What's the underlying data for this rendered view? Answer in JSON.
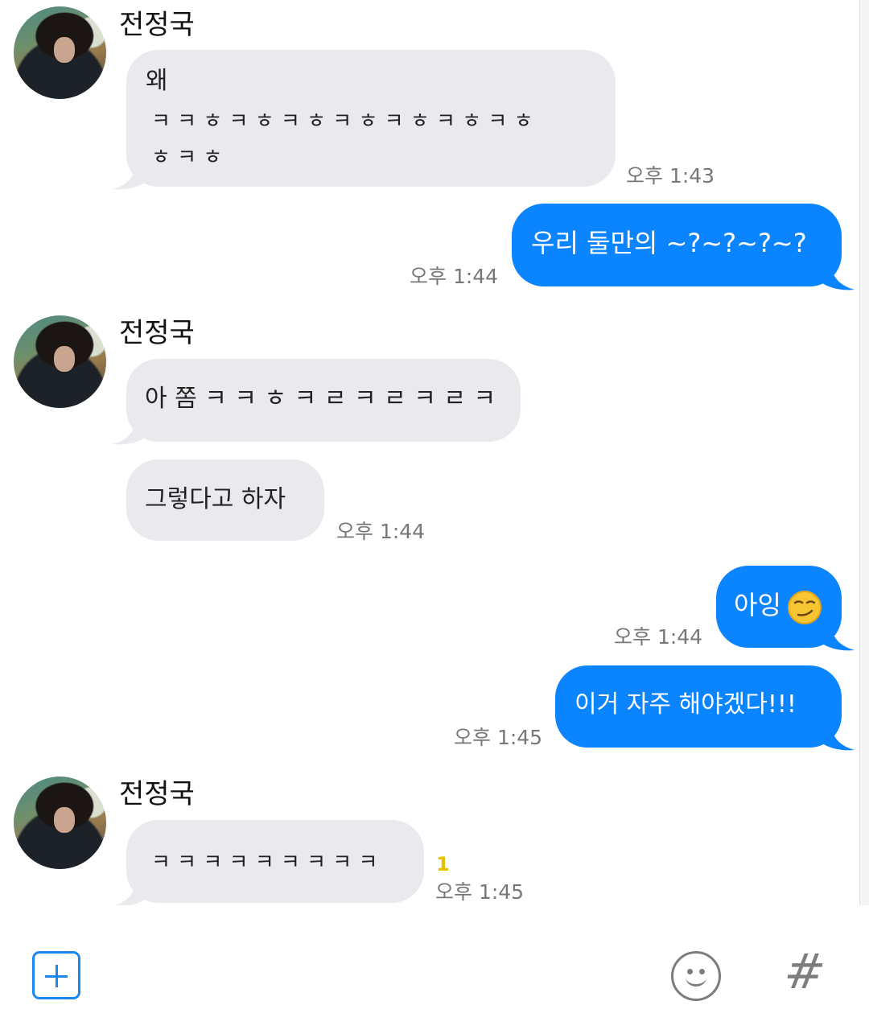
{
  "messages": [
    {
      "sender": "전정국",
      "lines": [
        "왜",
        "ㅋ ㅋ ㅎ ㅋ ㅎ ㅋ ㅎ ㅋ ㅎ ㅋ ㅎ ㅋ ㅎ ㅋ ㅎ",
        "ㅎ ㅋ ㅎ"
      ],
      "time": "오후 1:43"
    },
    {
      "sender": "me",
      "text": "우리 둘만의 ~?~?~?~?",
      "time": "오후 1:44"
    },
    {
      "sender": "전정국",
      "text": "아 쫌 ㅋ ㅋ ㅎ ㅋ ㄹ ㅋ ㄹ ㅋ ㄹ ㅋ"
    },
    {
      "sender": "전정국",
      "text": "그렇다고 하자",
      "time": "오후 1:44"
    },
    {
      "sender": "me",
      "text": "아잉",
      "emoji": "smirking-face",
      "time": "오후 1:44"
    },
    {
      "sender": "me",
      "text": "이거 자주 해야겠다!!!",
      "time": "오후 1:45"
    },
    {
      "sender": "전정국",
      "text": "ㅋ ㅋ ㅋ ㅋ ㅋ ㅋ ㅋ ㅋ ㅋ",
      "unread": "1",
      "time": "오후 1:45"
    }
  ],
  "colors": {
    "outgoing": "#0a84ff",
    "incoming": "#e9e9ee",
    "accent": "#1b86f0",
    "unread": "#e8c000"
  },
  "toolbar": {
    "add_icon": "plus-square-icon",
    "emoji_icon": "smiley-icon",
    "hashtag_label": "#"
  }
}
